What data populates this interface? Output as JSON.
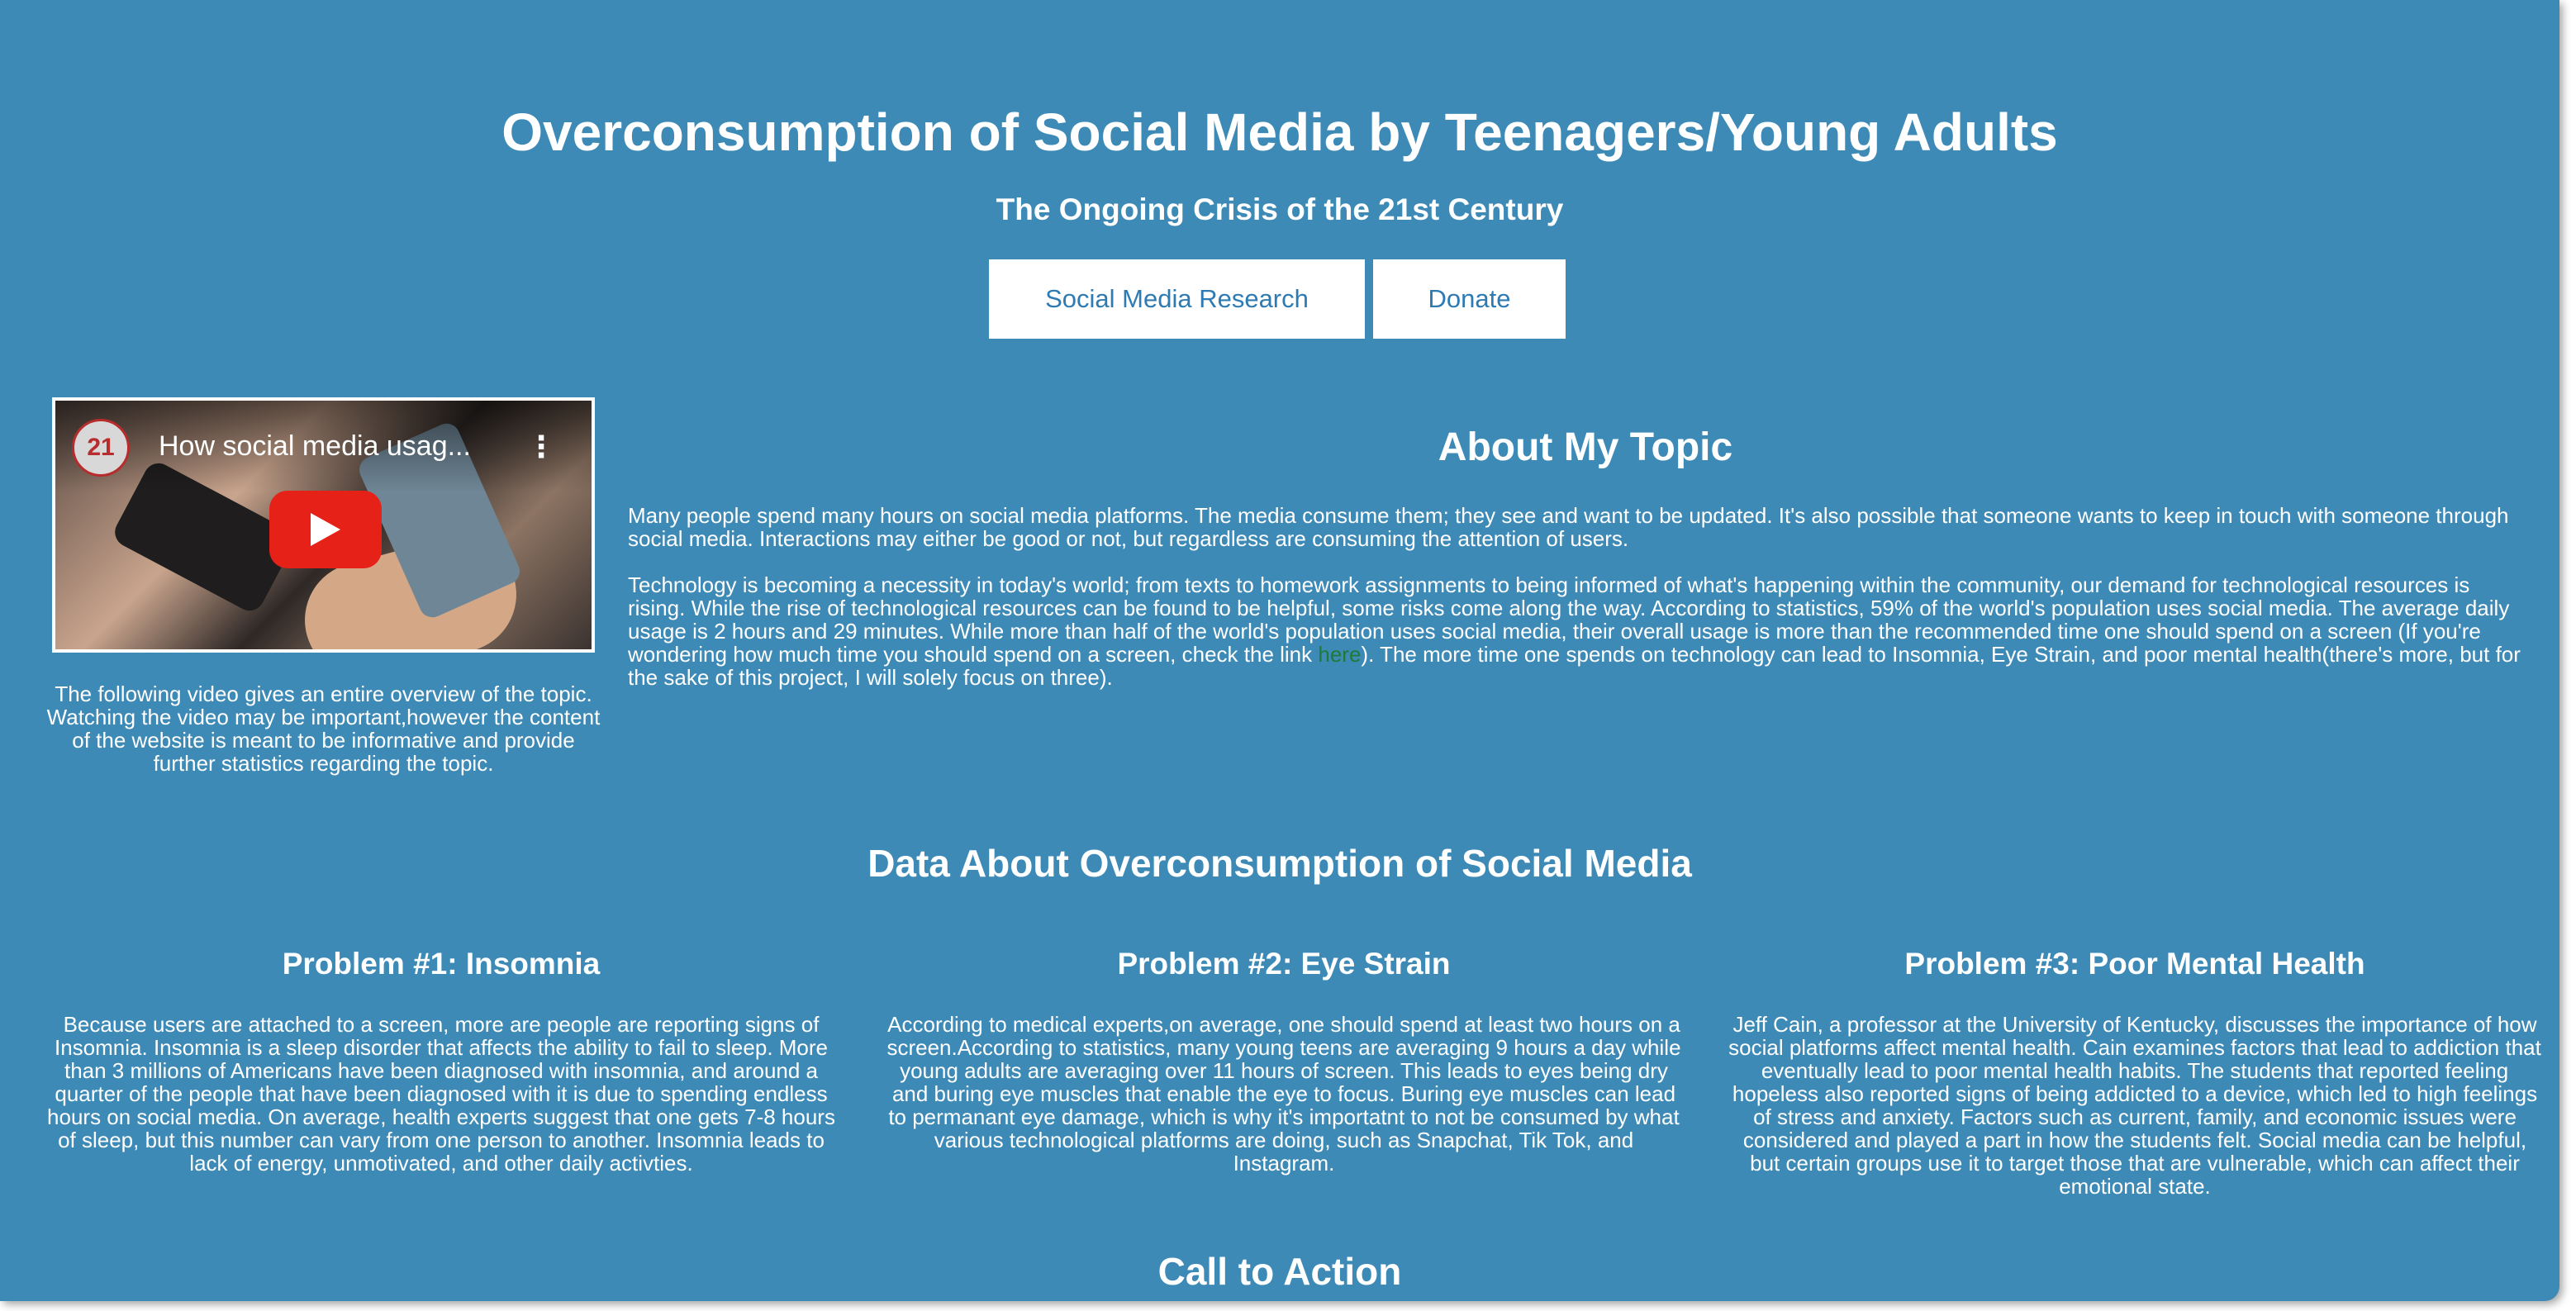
{
  "header": {
    "title": "Overconsumption of Social Media by Teenagers/Young Adults",
    "subtitle": "The Ongoing Crisis of the 21st Century"
  },
  "nav": {
    "items": [
      {
        "label": "Social Media Research"
      },
      {
        "label": "Donate"
      }
    ]
  },
  "video": {
    "title": "How social media usag...",
    "channel_logo_text": "21",
    "icons": [
      "channel-logo",
      "more-vertical-icon",
      "youtube-play-icon"
    ],
    "caption": "The following video gives an entire overview of the topic. Watching the video may be important,however the content of the website is meant to be informative and provide further statistics regarding the topic."
  },
  "about": {
    "title": "About My Topic",
    "p1": "Many people spend many hours on social media platforms. The media consume them; they see and want to be updated. It's also possible that someone wants to keep in touch with someone through social media. Interactions may either be good or not, but regardless are consuming the attention of users.",
    "p2_before_link": "Technology is becoming a necessity in today's world; from texts to homework assignments to being informed of what's happening within the community, our demand for technological resources is rising. While the rise of technological resources can be found to be helpful, some risks come along the way. According to statistics, 59% of the world's population uses social media. The average daily usage is 2 hours and 29 minutes. While more than half of the world's population uses social media, their overall usage is more than the recommended time one should spend on a screen (If you're wondering how much time you should spend on a screen, check the link ",
    "p2_link": "here",
    "p2_after_link": "). The more time one spends on technology can lead to Insomnia, Eye Strain, and poor mental health(there's more, but for the sake of this project, I will solely focus on three).",
    "link_color": "#1f7a3a"
  },
  "data_section": {
    "title": "Data About Overconsumption of Social Media",
    "problems": [
      {
        "title": "Problem #1: Insomnia",
        "text": "Because users are attached to a screen, more are people are reporting signs of Insomnia. Insomnia is a sleep disorder that affects the ability to fail to sleep. More than 3 millions of Americans have been diagnosed with insomnia, and around a quarter of the people that have been diagnosed with it is due to spending endless hours on social media. On average, health experts suggest that one gets 7-8 hours of sleep, but this number can vary from one person to another. Insomnia leads to lack of energy, unmotivated, and other daily activties."
      },
      {
        "title": "Problem #2: Eye Strain",
        "text": "According to medical experts,on average, one should spend at least two hours on a screen.According to statistics, many young teens are averaging 9 hours a day while young adults are averaging over 11 hours of screen. This leads to eyes being dry and buring eye muscles that enable the eye to focus. Buring eye muscles can lead to permanant eye damage, which is why it's importatnt to not be consumed by what various technological platforms are doing, such as Snapchat, Tik Tok, and Instagram."
      },
      {
        "title": "Problem #3: Poor Mental Health",
        "text": "Jeff Cain, a professor at the University of Kentucky, discusses the importance of how social platforms affect mental health. Cain examines factors that lead to addiction that eventually lead to poor mental health habits. The students that reported feeling hopeless also reported signs of being addicted to a device, which led to high feelings of stress and anxiety. Factors such as current, family, and economic issues were considered and played a part in how the students felt. Social media can be helpful, but certain groups use it to target those that are vulnerable, which can affect their emotional state."
      }
    ]
  },
  "cta": {
    "title": "Call to Action"
  },
  "colors": {
    "background": "#3d8ab7",
    "text": "#ffffff",
    "button_bg": "#ffffff",
    "button_text": "#2e7bb3",
    "play_button": "#e62117"
  }
}
